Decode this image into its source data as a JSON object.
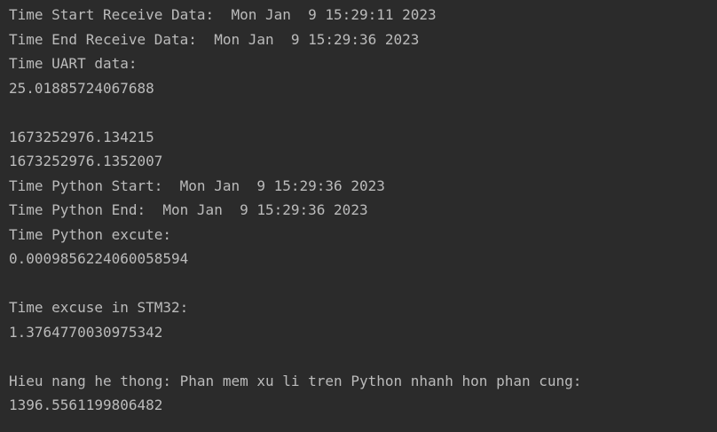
{
  "console": {
    "lines": [
      "Time Start Receive Data:  Mon Jan  9 15:29:11 2023",
      "Time End Receive Data:  Mon Jan  9 15:29:36 2023",
      "Time UART data:",
      "25.01885724067688",
      "",
      "1673252976.134215",
      "1673252976.1352007",
      "Time Python Start:  Mon Jan  9 15:29:36 2023",
      "Time Python End:  Mon Jan  9 15:29:36 2023",
      "Time Python excute:",
      "0.0009856224060058594",
      "",
      "Time excuse in STM32:",
      "1.3764770030975342",
      "",
      "Hieu nang he thong: Phan mem xu li tren Python nhanh hon phan cung:",
      "1396.5561199806482"
    ]
  },
  "colors": {
    "background": "#2b2b2b",
    "text": "#bbbbbb"
  }
}
